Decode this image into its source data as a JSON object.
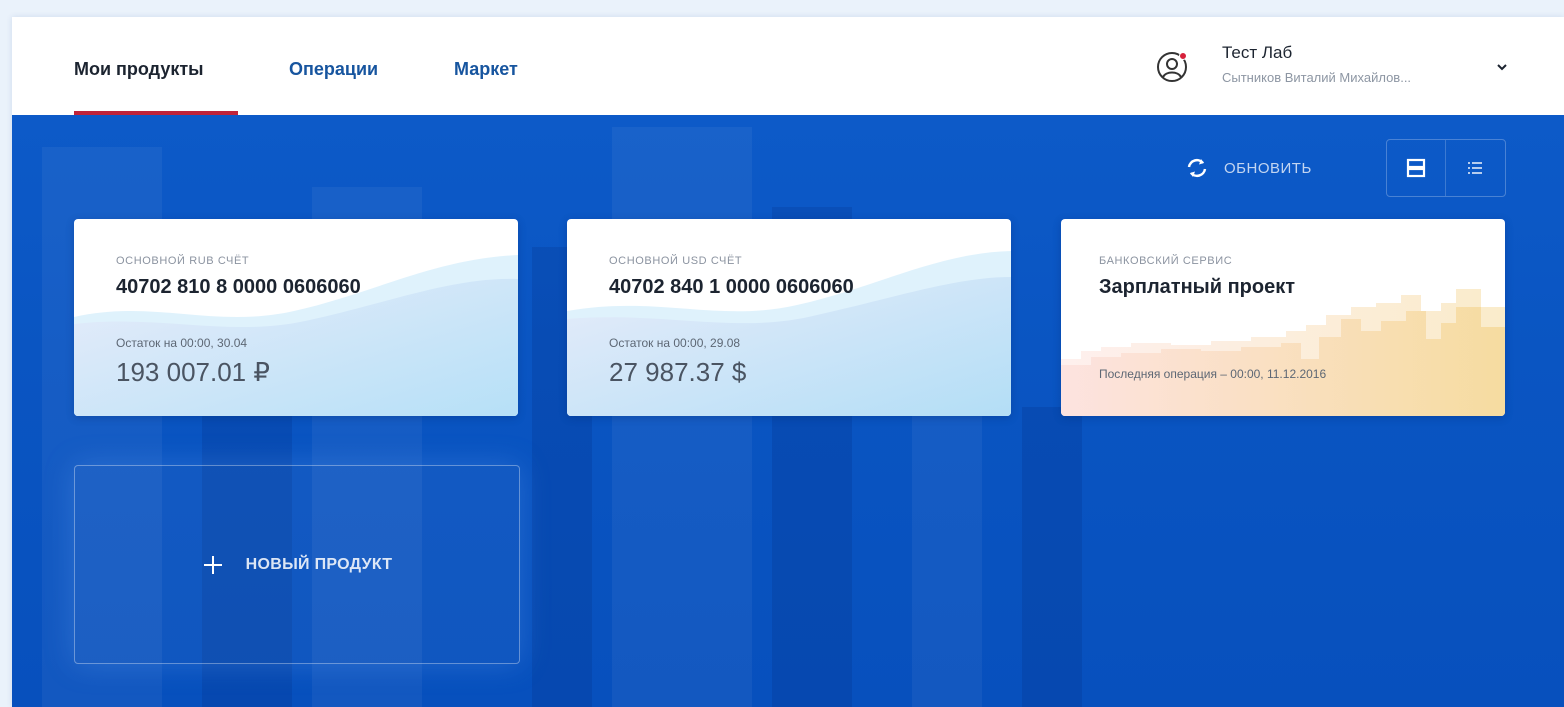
{
  "nav": {
    "tabs": [
      {
        "label": "Мои продукты",
        "active": true
      },
      {
        "label": "Операции",
        "active": false
      },
      {
        "label": "Маркет",
        "active": false
      }
    ]
  },
  "user": {
    "name": "Тест Лаб",
    "subtitle": "Сытников Виталий Михайлов..."
  },
  "toolbar": {
    "refresh_label": "ОБНОВИТЬ"
  },
  "products": [
    {
      "label": "ОСНОВНОЙ RUB СЧЁТ",
      "number": "40702 810 8 0000 0606060",
      "balance_caption": "Остаток на 00:00, 30.04",
      "balance": "193 007.01 ₽"
    },
    {
      "label": "ОСНОВНОЙ USD СЧЁТ",
      "number": "40702 840 1 0000 0606060",
      "balance_caption": "Остаток на 00:00, 29.08",
      "balance": "27 987.37 $"
    },
    {
      "label": "БАНКОВСКИЙ СЕРВИС",
      "title": "Зарплатный проект",
      "last_operation": "Последняя операция – 00:00, 11.12.2016"
    }
  ],
  "new_product": {
    "label": "НОВЫЙ ПРОДУКТ"
  },
  "colors": {
    "accent_underline": "#c0233a",
    "link": "#17559f",
    "hero_blue": "#0a55c2"
  }
}
